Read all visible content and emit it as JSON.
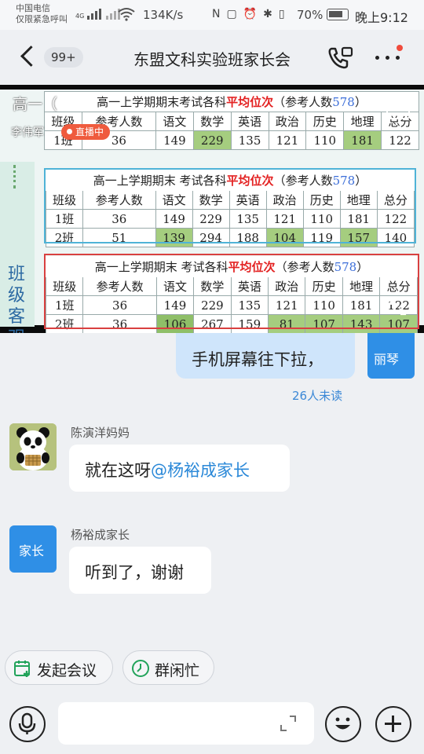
{
  "status_bar": {
    "carrier_line1": "中国电信",
    "carrier_line2": "仅限紧急呼叫",
    "net_badge": "4G",
    "net_speed": "134K/s",
    "battery": "70%",
    "time": "晚上9:12"
  },
  "header": {
    "unread_count": "99+",
    "title": "东盟文科实验班家长会",
    "accent_color": "#2a88d8"
  },
  "live": {
    "overlay_title": "高一（",
    "presenter": "李伟军",
    "badge": "直播中",
    "side_label": "班级客观认识",
    "tables": [
      {
        "title_prefix": "高一上学期期末考试各科",
        "title_red": "平均位次",
        "title_suffix": "（参考人数",
        "title_count": "578",
        "title_close": "）",
        "headers": [
          "班级",
          "参考人数",
          "语文",
          "数学",
          "英语",
          "政治",
          "历史",
          "地理",
          "总分"
        ],
        "rows": [
          [
            "1班",
            "36",
            "149",
            "229",
            "135",
            "121",
            "110",
            "181",
            "122"
          ]
        ]
      },
      {
        "title_prefix": "高一上学期期末 考试各科",
        "title_red": "平均位次",
        "title_suffix": "（参考人数",
        "title_count": "578",
        "title_close": "）",
        "headers": [
          "班级",
          "参考人数",
          "语文",
          "数学",
          "英语",
          "政治",
          "历史",
          "地理",
          "总分"
        ],
        "rows": [
          [
            "1班",
            "36",
            "149",
            "229",
            "135",
            "121",
            "110",
            "181",
            "122"
          ],
          [
            "2班",
            "51",
            "139",
            "294",
            "188",
            "104",
            "119",
            "157",
            "140"
          ]
        ]
      },
      {
        "title_prefix": "高一上学期期末 考试各科",
        "title_red": "平均位次",
        "title_suffix": "（参考人数",
        "title_count": "578",
        "title_close": "）",
        "headers": [
          "班级",
          "参考人数",
          "语文",
          "数学",
          "英语",
          "政治",
          "历史",
          "地理",
          "总分"
        ],
        "rows": [
          [
            "1班",
            "36",
            "149",
            "229",
            "135",
            "121",
            "110",
            "181",
            "122"
          ],
          [
            "2班",
            "36",
            "106",
            "267",
            "159",
            "81",
            "107",
            "143",
            "107"
          ]
        ]
      }
    ]
  },
  "messages": {
    "partial_text": "手机屏幕往下拉，",
    "my_avatar_text": "丽琴",
    "read_status": "26人未读",
    "msg1": {
      "sender": "陈演洋妈妈",
      "text": "就在这呀",
      "mention": "@杨裕成家长"
    },
    "msg2": {
      "sender": "杨裕成家长",
      "avatar_text": "家长",
      "text": "听到了，谢谢"
    }
  },
  "quick_actions": {
    "meeting": "发起会议",
    "busy": "群闲忙"
  },
  "composer": {
    "placeholder": ""
  }
}
